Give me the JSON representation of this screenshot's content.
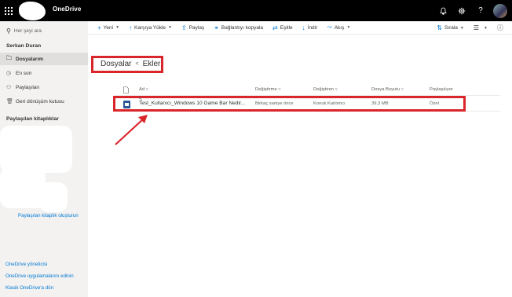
{
  "topbar": {
    "app_name": "OneDrive",
    "icons": [
      "waffle-icon",
      "bell-icon",
      "gear-icon",
      "help-icon",
      "avatar"
    ]
  },
  "search": {
    "placeholder": "Her şeyi ara"
  },
  "leftnav": {
    "user_name": "Serkan Duran",
    "items": [
      {
        "label": "Dosyalarım",
        "icon": "folder-icon",
        "active": true
      },
      {
        "label": "En son",
        "icon": "clock-icon",
        "active": false
      },
      {
        "label": "Paylaşılan",
        "icon": "people-icon",
        "active": false
      },
      {
        "label": "Geri dönüşüm kutusu",
        "icon": "recycle-bin-icon",
        "active": false
      }
    ],
    "shared_libraries_heading": "Paylaşılan kitaplıklar",
    "create_library_link": "Paylaşılan kitaplık oluşturun",
    "footer_links": [
      "OneDrive yöneticisi",
      "OneDrive uygulamalarını edinin",
      "Klasik OneDrive'a dön"
    ]
  },
  "commandbar": {
    "new": "Yeni",
    "upload": "Karşıya Yükle",
    "share": "Paylaş",
    "copy_link": "Bağlantıyı kopyala",
    "sync": "Eşitle",
    "download": "İndir",
    "flow": "Akış",
    "sort": "Sırala"
  },
  "breadcrumb": {
    "parent": "Dosyalar",
    "current": "Ekler"
  },
  "list": {
    "columns": [
      "Ad",
      "Değiştirme",
      "Değiştiren",
      "Dosya Boyutu",
      "Paylaşılıyor"
    ],
    "rows": [
      {
        "name": "Test_Kullanıcı_Windows 10 Game Bar Nedir...",
        "modified": "Birkaç saniye önce",
        "modified_by": "Konuk Katılımcı",
        "size": "39,3 MB",
        "sharing": "Özel"
      }
    ]
  },
  "colors": {
    "accent": "#0078d4",
    "highlight": "#d9262b",
    "topbar": "#000000",
    "nav_bg": "#f3f2f1"
  }
}
